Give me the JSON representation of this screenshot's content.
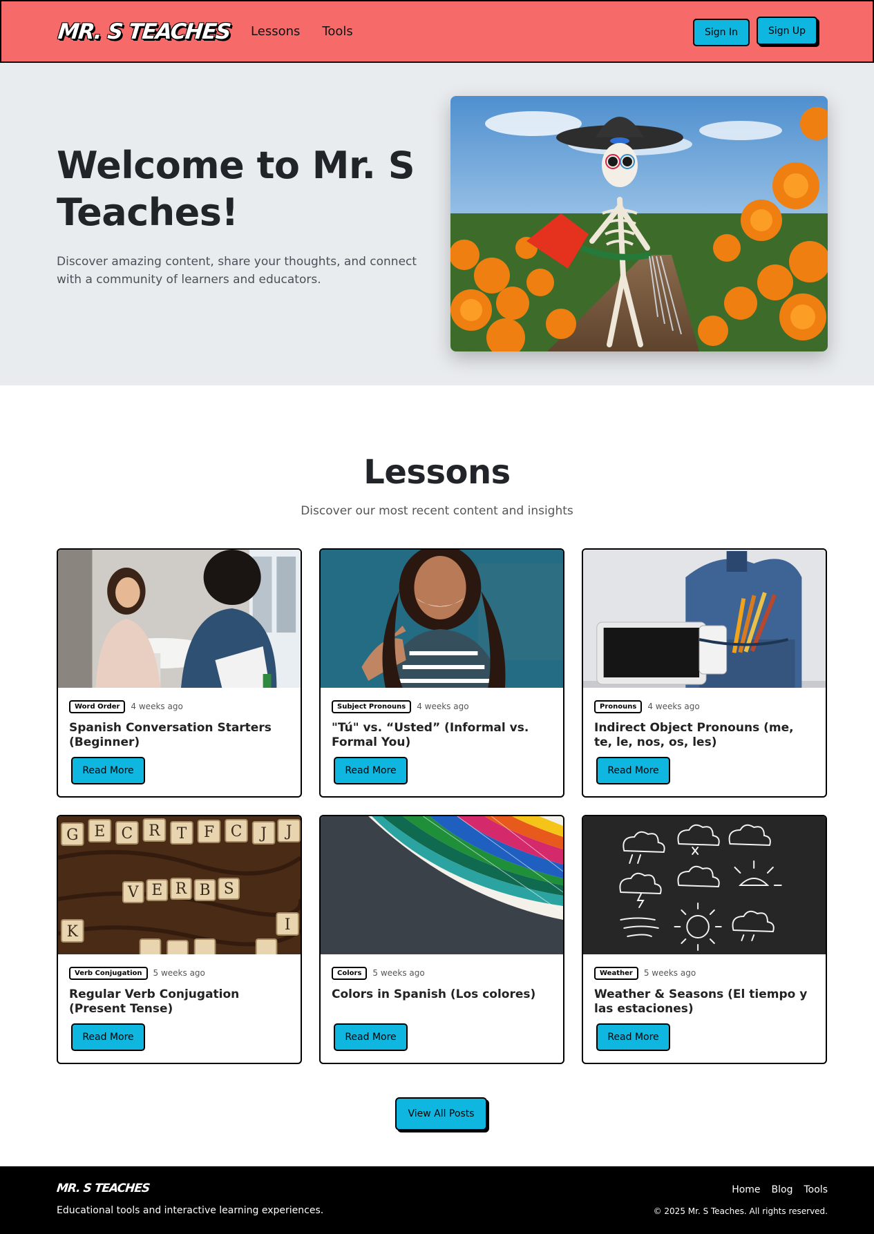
{
  "header": {
    "brand": "MR. S TEACHES",
    "nav": [
      {
        "label": "Lessons"
      },
      {
        "label": "Tools"
      }
    ],
    "sign_in_label": "Sign In",
    "sign_up_label": "Sign Up"
  },
  "hero": {
    "title": "Welcome to Mr. S Teaches!",
    "text": "Discover amazing content, share your thoughts, and connect with a community of learners and educators."
  },
  "lessons": {
    "title": "Lessons",
    "subtitle": "Discover our most recent content and insights",
    "cards": [
      {
        "category": "Word Order",
        "date": "4 weeks ago",
        "title": "Spanish Conversation Starters (Beginner)",
        "button": "Read More"
      },
      {
        "category": "Subject Pronouns",
        "date": "4 weeks ago",
        "title": "\"Tú\" vs. “Usted” (Informal vs. Formal You)",
        "button": "Read More"
      },
      {
        "category": "Pronouns",
        "date": "4 weeks ago",
        "title": "Indirect Object Pronouns (me, te, le, nos, os, les)",
        "button": "Read More"
      },
      {
        "category": "Verb Conjugation",
        "date": "5 weeks ago",
        "title": "Regular Verb Conjugation (Present Tense)",
        "button": "Read More"
      },
      {
        "category": "Colors",
        "date": "5 weeks ago",
        "title": "Colors in Spanish (Los colores)",
        "button": "Read More"
      },
      {
        "category": "Weather",
        "date": "5 weeks ago",
        "title": "Weather & Seasons (El tiempo y las estaciones)",
        "button": "Read More"
      }
    ],
    "view_all_label": "View All Posts"
  },
  "footer": {
    "brand": "MR. S TEACHES",
    "tagline": "Educational tools and interactive learning experiences.",
    "links": [
      {
        "label": "Home"
      },
      {
        "label": "Blog"
      },
      {
        "label": "Tools"
      }
    ],
    "copyright": "© 2025 Mr. S Teaches. All rights reserved."
  },
  "colors": {
    "navbar": "#f76a6a",
    "button": "#0fb6e0",
    "hero_bg": "#e9ecef",
    "footer": "#000000"
  }
}
